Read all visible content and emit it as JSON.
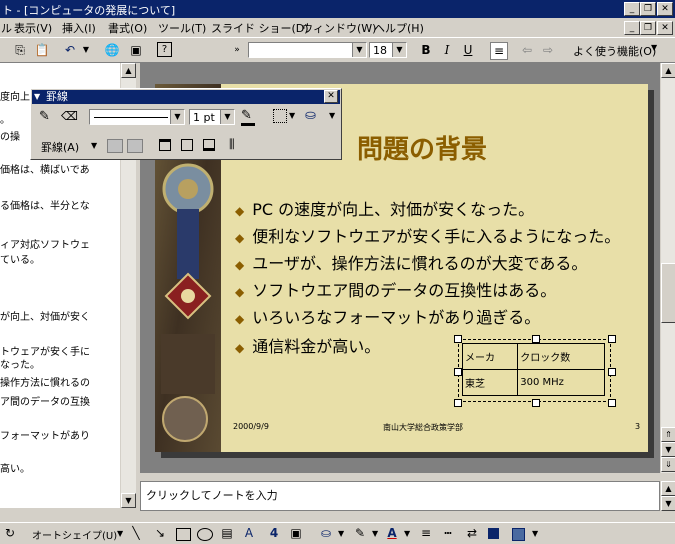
{
  "window": {
    "title": "ト - [コンピュータの発展について]"
  },
  "menu": {
    "items": [
      "ル",
      "表示(V)",
      "挿入(I)",
      "書式(O)",
      "ツール(T)",
      "スライド ショー(D)",
      "ウィンドウ(W)",
      "ヘルプ(H)"
    ]
  },
  "toolbar": {
    "font_size": "18",
    "bold": "B",
    "italic": "I",
    "underline": "U",
    "frequent_functions": "よく使う機能(O)"
  },
  "outline": {
    "lines": [
      "度向上",
      "。",
      "の操",
      "価格は、横ばいであ",
      "",
      "る価格は、半分とな",
      "",
      "ィア対応ソフトウェ",
      "ている。",
      "",
      "",
      "が向上、対価が安く",
      "",
      "トウェアが安く手に",
      "なった。",
      "操作方法に慣れるの",
      "ア間のデータの互換",
      "",
      "フォーマットがあり",
      "",
      "高い。"
    ]
  },
  "lines_toolbar": {
    "title": "罫線",
    "line_weight": "1 pt",
    "lines_menu": "罫線(A)"
  },
  "slide": {
    "title": "問題の背景",
    "bullets": [
      "PC の速度が向上、対価が安くなった。",
      "便利なソフトウエアが安く手に入るようになった。",
      "ユーザが、操作方法に慣れるのが大変である。",
      "ソフトウエア間のデータの互換性はある。",
      "いろいろなフォーマットがあり過ぎる。",
      "通信料金が高い。"
    ],
    "table": {
      "header": [
        "メーカ",
        "クロック数"
      ],
      "row": [
        "東芝",
        "300 MHz"
      ]
    },
    "footer_date": "2000/9/9",
    "footer_center": "南山大学総合政策学部",
    "footer_page": "3"
  },
  "notes": {
    "placeholder": "クリックしてノートを入力"
  },
  "drawing": {
    "autoshape": "オートシェイプ(U)"
  }
}
